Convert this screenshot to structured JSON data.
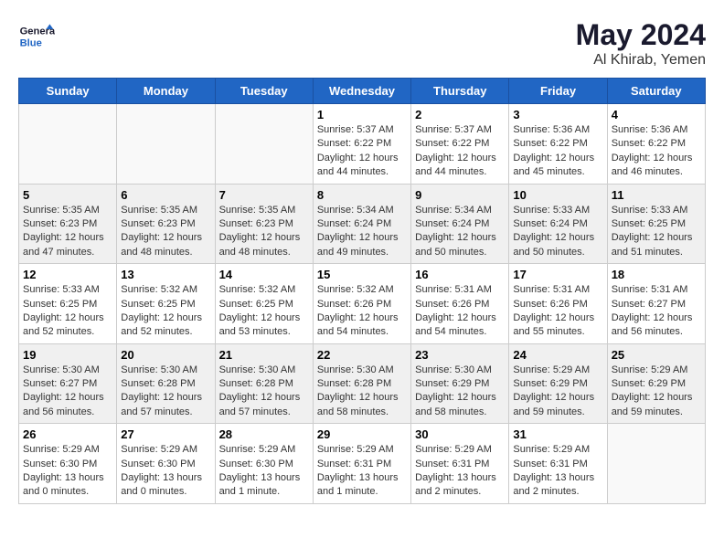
{
  "header": {
    "logo_line1": "General",
    "logo_line2": "Blue",
    "month_year": "May 2024",
    "location": "Al Khirab, Yemen"
  },
  "weekdays": [
    "Sunday",
    "Monday",
    "Tuesday",
    "Wednesday",
    "Thursday",
    "Friday",
    "Saturday"
  ],
  "weeks": [
    [
      {
        "day": "",
        "empty": true
      },
      {
        "day": "",
        "empty": true
      },
      {
        "day": "",
        "empty": true
      },
      {
        "day": "1",
        "sunrise": "5:37 AM",
        "sunset": "6:22 PM",
        "daylight": "12 hours and 44 minutes."
      },
      {
        "day": "2",
        "sunrise": "5:37 AM",
        "sunset": "6:22 PM",
        "daylight": "12 hours and 44 minutes."
      },
      {
        "day": "3",
        "sunrise": "5:36 AM",
        "sunset": "6:22 PM",
        "daylight": "12 hours and 45 minutes."
      },
      {
        "day": "4",
        "sunrise": "5:36 AM",
        "sunset": "6:22 PM",
        "daylight": "12 hours and 46 minutes."
      }
    ],
    [
      {
        "day": "5",
        "sunrise": "5:35 AM",
        "sunset": "6:23 PM",
        "daylight": "12 hours and 47 minutes."
      },
      {
        "day": "6",
        "sunrise": "5:35 AM",
        "sunset": "6:23 PM",
        "daylight": "12 hours and 48 minutes."
      },
      {
        "day": "7",
        "sunrise": "5:35 AM",
        "sunset": "6:23 PM",
        "daylight": "12 hours and 48 minutes."
      },
      {
        "day": "8",
        "sunrise": "5:34 AM",
        "sunset": "6:24 PM",
        "daylight": "12 hours and 49 minutes."
      },
      {
        "day": "9",
        "sunrise": "5:34 AM",
        "sunset": "6:24 PM",
        "daylight": "12 hours and 50 minutes."
      },
      {
        "day": "10",
        "sunrise": "5:33 AM",
        "sunset": "6:24 PM",
        "daylight": "12 hours and 50 minutes."
      },
      {
        "day": "11",
        "sunrise": "5:33 AM",
        "sunset": "6:25 PM",
        "daylight": "12 hours and 51 minutes."
      }
    ],
    [
      {
        "day": "12",
        "sunrise": "5:33 AM",
        "sunset": "6:25 PM",
        "daylight": "12 hours and 52 minutes."
      },
      {
        "day": "13",
        "sunrise": "5:32 AM",
        "sunset": "6:25 PM",
        "daylight": "12 hours and 52 minutes."
      },
      {
        "day": "14",
        "sunrise": "5:32 AM",
        "sunset": "6:25 PM",
        "daylight": "12 hours and 53 minutes."
      },
      {
        "day": "15",
        "sunrise": "5:32 AM",
        "sunset": "6:26 PM",
        "daylight": "12 hours and 54 minutes."
      },
      {
        "day": "16",
        "sunrise": "5:31 AM",
        "sunset": "6:26 PM",
        "daylight": "12 hours and 54 minutes."
      },
      {
        "day": "17",
        "sunrise": "5:31 AM",
        "sunset": "6:26 PM",
        "daylight": "12 hours and 55 minutes."
      },
      {
        "day": "18",
        "sunrise": "5:31 AM",
        "sunset": "6:27 PM",
        "daylight": "12 hours and 56 minutes."
      }
    ],
    [
      {
        "day": "19",
        "sunrise": "5:30 AM",
        "sunset": "6:27 PM",
        "daylight": "12 hours and 56 minutes."
      },
      {
        "day": "20",
        "sunrise": "5:30 AM",
        "sunset": "6:28 PM",
        "daylight": "12 hours and 57 minutes."
      },
      {
        "day": "21",
        "sunrise": "5:30 AM",
        "sunset": "6:28 PM",
        "daylight": "12 hours and 57 minutes."
      },
      {
        "day": "22",
        "sunrise": "5:30 AM",
        "sunset": "6:28 PM",
        "daylight": "12 hours and 58 minutes."
      },
      {
        "day": "23",
        "sunrise": "5:30 AM",
        "sunset": "6:29 PM",
        "daylight": "12 hours and 58 minutes."
      },
      {
        "day": "24",
        "sunrise": "5:29 AM",
        "sunset": "6:29 PM",
        "daylight": "12 hours and 59 minutes."
      },
      {
        "day": "25",
        "sunrise": "5:29 AM",
        "sunset": "6:29 PM",
        "daylight": "12 hours and 59 minutes."
      }
    ],
    [
      {
        "day": "26",
        "sunrise": "5:29 AM",
        "sunset": "6:30 PM",
        "daylight": "13 hours and 0 minutes."
      },
      {
        "day": "27",
        "sunrise": "5:29 AM",
        "sunset": "6:30 PM",
        "daylight": "13 hours and 0 minutes."
      },
      {
        "day": "28",
        "sunrise": "5:29 AM",
        "sunset": "6:30 PM",
        "daylight": "13 hours and 1 minute."
      },
      {
        "day": "29",
        "sunrise": "5:29 AM",
        "sunset": "6:31 PM",
        "daylight": "13 hours and 1 minute."
      },
      {
        "day": "30",
        "sunrise": "5:29 AM",
        "sunset": "6:31 PM",
        "daylight": "13 hours and 2 minutes."
      },
      {
        "day": "31",
        "sunrise": "5:29 AM",
        "sunset": "6:31 PM",
        "daylight": "13 hours and 2 minutes."
      },
      {
        "day": "",
        "empty": true
      }
    ]
  ]
}
